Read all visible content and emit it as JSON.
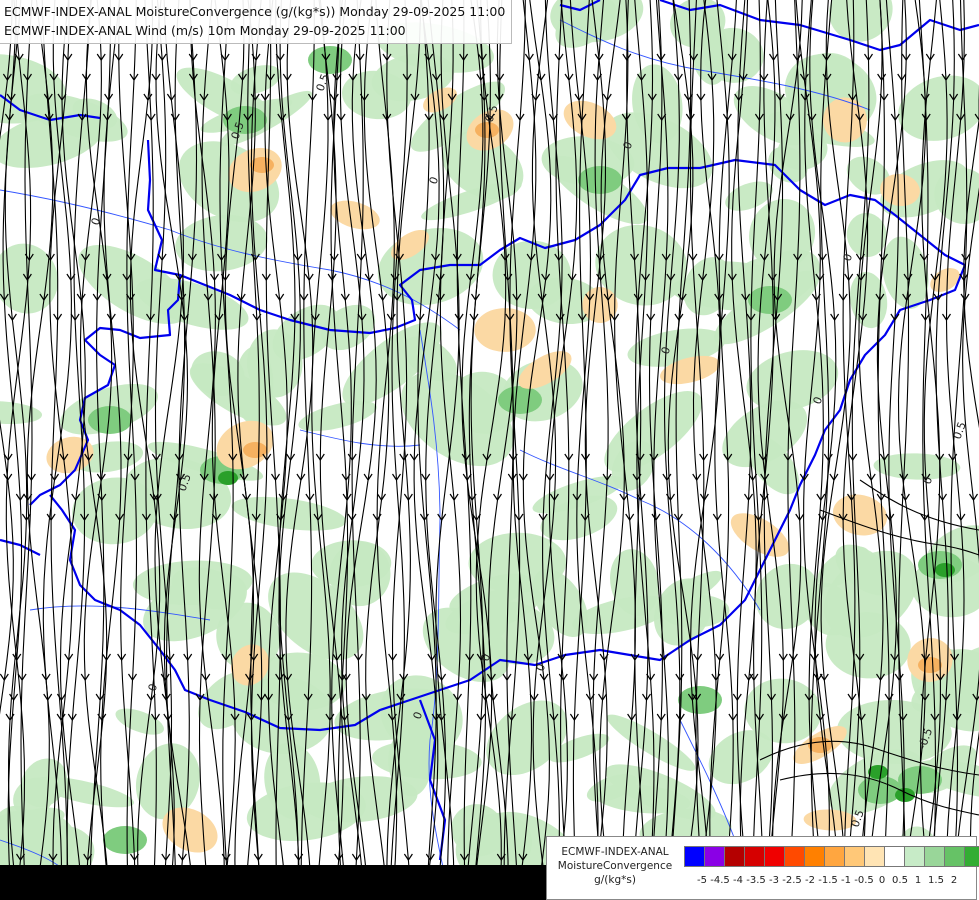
{
  "header": {
    "line1": "ECMWF-INDEX-ANAL MoistureConvergence (g/(kg*s)) Monday 29-09-2025 11:00",
    "line2": "ECMWF-INDEX-ANAL Wind (m/s) 10m Monday 29-09-2025 11:00"
  },
  "map": {
    "contour_labels": [
      "0",
      "-0.5",
      "0.5"
    ],
    "colors": {
      "border": "#0000ee",
      "river": "#3355ff",
      "streamline": "#000000",
      "pos_light": "#c6e9c2",
      "pos_mid": "#7fcc7f",
      "pos_strong": "#2aa02a",
      "neg_light": "#fbd9a4",
      "neg_mid": "#f6b160"
    }
  },
  "legend": {
    "title_line1": "ECMWF-INDEX-ANAL",
    "title_line2": "MoistureConvergence",
    "title_line3": "g/(kg*s)",
    "swatch_colors": [
      "#0000ff",
      "#8a00e6",
      "#b40000",
      "#d60000",
      "#f00000",
      "#ff4a00",
      "#ff8000",
      "#ffa640",
      "#ffc878",
      "#ffe4b4",
      "#ffffff",
      "#c7ebc7",
      "#99d699",
      "#66c266",
      "#33ad33",
      "#0a960a"
    ],
    "labels": [
      "-5",
      "-4.5",
      "-4",
      "-3.5",
      "-3",
      "-2.5",
      "-2",
      "-1.5",
      "-1",
      "-0.5",
      "0",
      "0.5",
      "1",
      "1.5",
      "2"
    ]
  }
}
